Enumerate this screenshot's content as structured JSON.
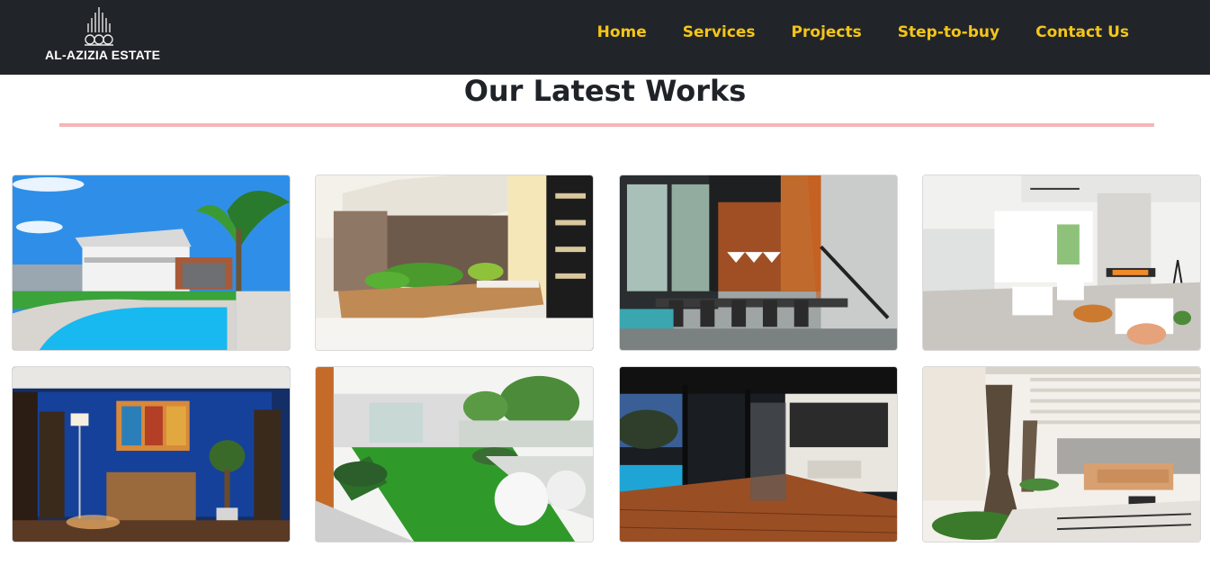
{
  "brand": {
    "name": "AL-AZIZIA ESTATE",
    "logo_icon": "building-skyline-logo",
    "accent_color": "#f5c518",
    "nav_bg": "#212529"
  },
  "nav": {
    "items": [
      {
        "label": "Home"
      },
      {
        "label": "Services"
      },
      {
        "label": "Projects"
      },
      {
        "label": "Step-to-buy"
      },
      {
        "label": "Contact Us"
      }
    ]
  },
  "section": {
    "title": "Our Latest Works",
    "divider_color": "#f4b6b8"
  },
  "gallery": {
    "images": [
      {
        "subject": "villa-with-pool"
      },
      {
        "subject": "interior-garden-stairs"
      },
      {
        "subject": "modern-dining-hall"
      },
      {
        "subject": "white-living-room"
      },
      {
        "subject": "blue-wall-living-room"
      },
      {
        "subject": "garden-patio"
      },
      {
        "subject": "wooden-deck-terrace"
      },
      {
        "subject": "tree-atrium-lounge"
      }
    ]
  }
}
